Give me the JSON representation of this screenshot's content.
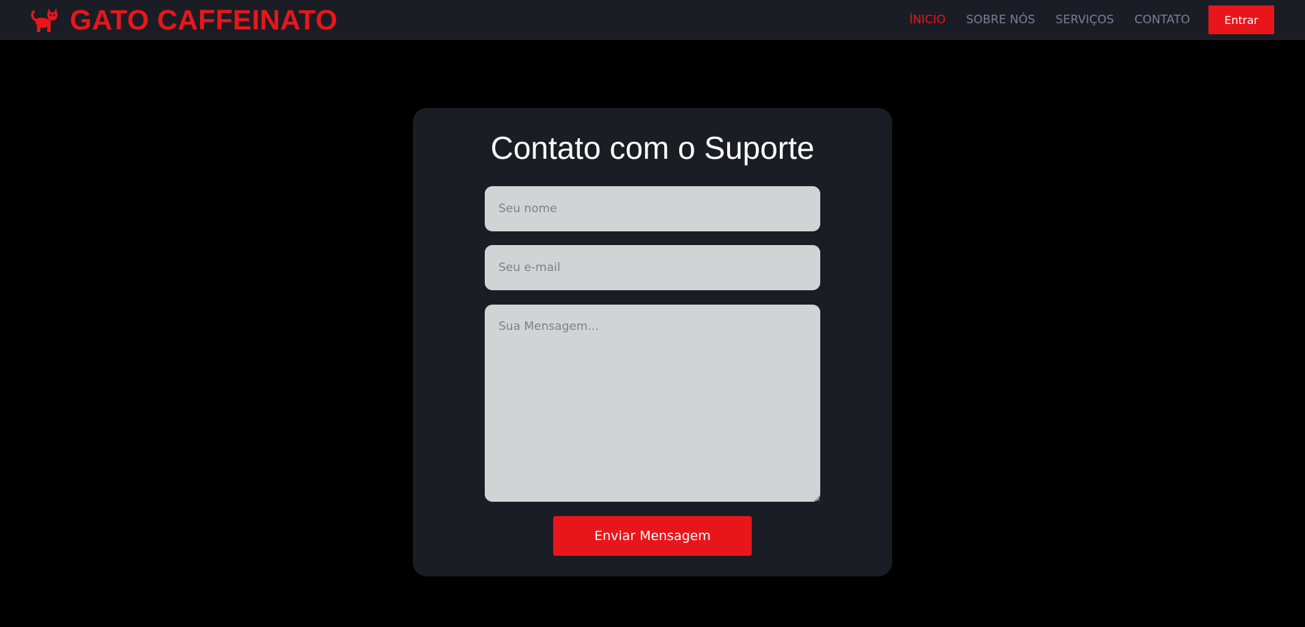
{
  "brand": {
    "name": "GATO CAFFEINATO",
    "icon": "cat-icon",
    "color": "#e8161b"
  },
  "nav": {
    "links": [
      {
        "label": "ÍNICIO",
        "active": true
      },
      {
        "label": "SOBRE NÓS",
        "active": false
      },
      {
        "label": "SERVIÇOS",
        "active": false
      },
      {
        "label": "CONTATO",
        "active": false
      }
    ],
    "login_label": "Entrar"
  },
  "form": {
    "title": "Contato com o Suporte",
    "name_placeholder": "Seu nome",
    "email_placeholder": "Seu e-mail",
    "message_placeholder": "Sua Mensagem...",
    "name_value": "",
    "email_value": "",
    "message_value": "",
    "submit_label": "Enviar Mensagem"
  },
  "colors": {
    "accent": "#e8161b",
    "navbar_bg": "#1b1d25",
    "page_bg": "#000000",
    "nav_text": "#7a7d9a",
    "field_bg": "#d2d3d5"
  }
}
